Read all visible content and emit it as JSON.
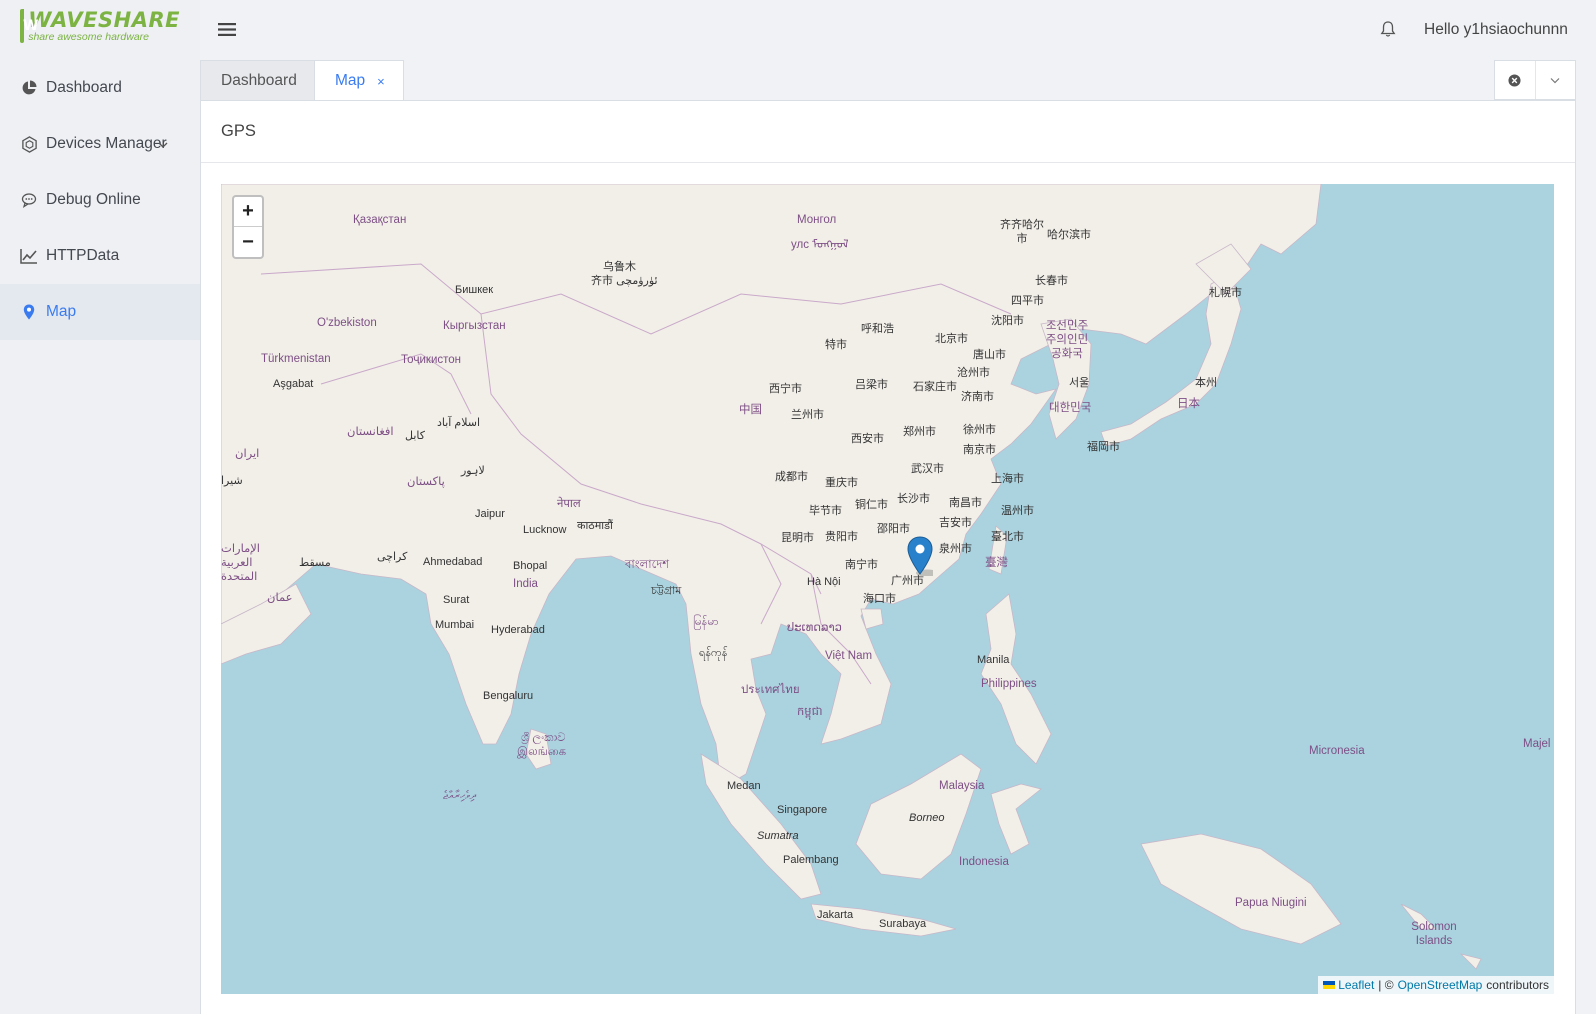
{
  "brand": {
    "name": "WAVESHARE",
    "tagline": "share awesome hardware",
    "mark": "W",
    "color": "#7cb342"
  },
  "sidebar": {
    "items": [
      {
        "label": "Dashboard",
        "icon": "pie-chart-icon"
      },
      {
        "label": "Devices Manager",
        "icon": "hexagon-icon",
        "has_submenu": true
      },
      {
        "label": "Debug Online",
        "icon": "chat-bubble-icon"
      },
      {
        "label": "HTTPData",
        "icon": "line-chart-icon"
      },
      {
        "label": "Map",
        "icon": "map-pin-icon",
        "active": true
      }
    ]
  },
  "header": {
    "greeting": "Hello y1hsiaochunnn"
  },
  "tabs": [
    {
      "label": "Dashboard"
    },
    {
      "label": "Map",
      "close": "×",
      "active": true
    }
  ],
  "panel": {
    "title": "GPS"
  },
  "map": {
    "zoom_in": "+",
    "zoom_out": "−",
    "attribution": {
      "leaflet": "Leaflet",
      "sep": "| ©",
      "osm": "OpenStreetMap",
      "suffix": "contributors"
    },
    "marker_label": "广州市",
    "labels": [
      "Қазақстан",
      "Монгол",
      "улс ᠮᠣᠩᠭᠣᠯ",
      "乌鲁木",
      "齐市 ئۈرۈمچی",
      "Бишкек",
      "O'zbekiston",
      "Кыргызстан",
      "Türkmenistan",
      "Aşgabat",
      "Тоҷикистон",
      "افغانستان",
      "کابل",
      "اسلام آباد",
      "لاہور",
      "پاکستان",
      "ایران",
      "شیرا",
      "الإمارات العربية المتحدة",
      "مسقط",
      "عمان",
      "کراچی",
      "Ahmedabad",
      "Jaipur",
      "नेपाल",
      "काठमाडौं",
      "Lucknow",
      "Bhopal",
      "India",
      "Surat",
      "Mumbai",
      "Hyderabad",
      "Bengaluru",
      "ශ්‍රී ලංකාව",
      "இலங்கை",
      "ދިވެހިރާއްޖެ",
      "বাংলাদেশ",
      "চট্টগ্রাম",
      "မြန်မာ",
      "ရန်ကုန်",
      "ประเทศไทย",
      "ປະເທດລາວ",
      "Việt Nam",
      "កម្ពុជា",
      "Hà Nội",
      "Medan",
      "Singapore",
      "Sumatra",
      "Palembang",
      "Jakarta",
      "Surabaya",
      "Borneo",
      "Malaysia",
      "Indonesia",
      "Manila",
      "Philippines",
      "Papua Niugini",
      "Micronesia",
      "Solomon Islands",
      "Majel",
      "中国",
      "西宁市",
      "兰州市",
      "吕梁市",
      "石家庄市",
      "特市",
      "呼和浩",
      "北京市",
      "唐山市",
      "沧州市",
      "济南市",
      "西安市",
      "郑州市",
      "徐州市",
      "南京市",
      "武汉市",
      "上海市",
      "成都市",
      "重庆市",
      "长沙市",
      "南昌市",
      "毕节市",
      "铜仁市",
      "吉安市",
      "温州市",
      "昆明市",
      "贵阳市",
      "邵阳市",
      "泉州市",
      "臺北市",
      "臺灣",
      "南宁市",
      "海口市",
      "齐齐哈尔市",
      "哈尔滨市",
      "长春市",
      "四平市",
      "沈阳市",
      "조선민주주의인민공화국",
      "서울",
      "대한민국",
      "福岡市",
      "日本",
      "本州",
      "札幌市"
    ]
  }
}
